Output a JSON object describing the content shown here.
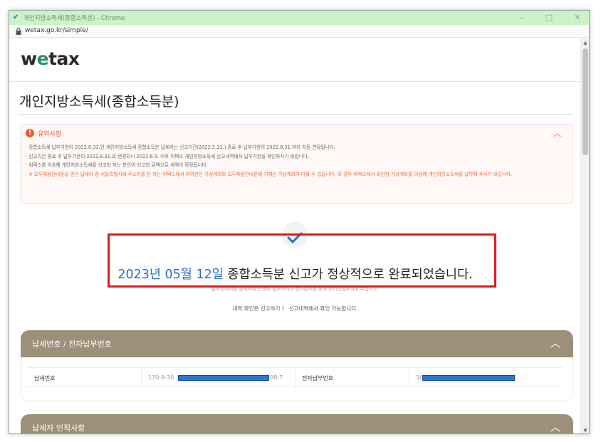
{
  "window": {
    "title": "개인지방소득세(종합소득분) - Chrome",
    "controls": {
      "minimize": "–",
      "maximize": "□",
      "close": "✕"
    }
  },
  "address_bar": {
    "url": "wetax.go.kr/simple/"
  },
  "site": {
    "logo_prefix": "w",
    "logo_at": "e",
    "logo_suffix": "tax"
  },
  "page": {
    "title": "개인지방소득세(종합소득분)"
  },
  "notice": {
    "title": "유의사항",
    "items": [
      "· 종합소득세 납부기한이 2022.8.31.인 개인지방소득세 종합소득분 납세자는 신고기간(2022.5.31.) 종료 후 납부기한이 2022.8.31.까지 자동 연장됩니다.",
      "· 신고기간 종료 후 납부기한이 2022.8.31.로 변경되니 2022.6.9. 이후 위택스 개인지방소득세 신고내역에서 납부기한을 확인하시기 바랍니다.",
      "· 위택스를 이용해 개인지방소득세를 신고한 자는 분인이 신고한 금액으로 세액이 확정됩니다."
    ],
    "warning": "· ※ 모두채움안내문을 받은 납세자 중 서울특별시에 주소지를 둔 자는 위택스에서 부여받은 가상계좌와 모두채움안내문에 기재된 가상계좌가 다를 수 있습니다. 이 경우 위택스에서 확인한 가상계좌를 이용해 개인지방소득세를 납부해 주시기 바랍니다."
  },
  "completion": {
    "date": "2023년 05월 12일",
    "message": " 종합소득분 신고가 정상적으로 완료되었습니다.",
    "sub": "납부안내서를 출력하여 은행에 납부하거나 전자납부를 통해 인터넷납부하여 주십시오.",
    "info": "내역 확인은 신고하기 〉 신고내역에서 확인 가능합니다."
  },
  "payment_panel": {
    "title": "납세번호 / 전자납부번호",
    "tax_no_label": "납세번호",
    "tax_no_prefix": "170-9-30",
    "tax_no_suffix": "08-7",
    "epay_label": "전자납부번호",
    "epay_prefix": "3("
  },
  "taxpayer_panel": {
    "title": "납세자 인적사항"
  },
  "colors": {
    "accent": "#2b6cc4",
    "panel": "#9d8f79",
    "warning": "#e4572e",
    "highlight": "#e21919",
    "logo_green": "#2e8d6b"
  }
}
